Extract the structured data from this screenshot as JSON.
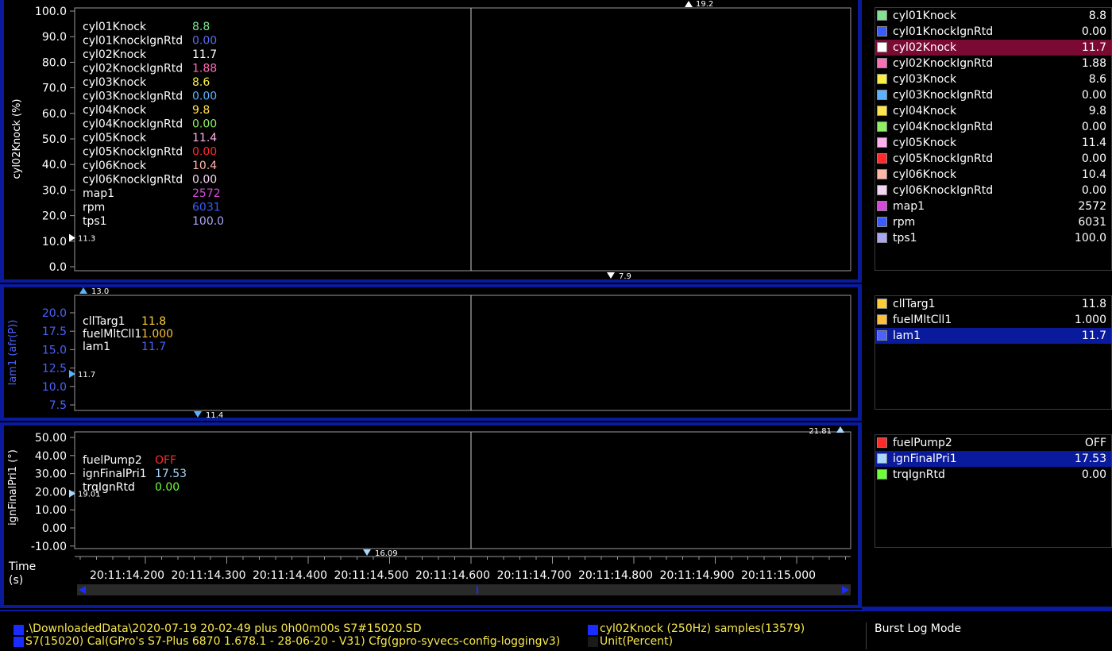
{
  "colors": {
    "frame": "#0a1a9c",
    "plot_bg": "#000000",
    "knock_fill": "#3a3a40",
    "selection_red": "#7a0a32",
    "selection_blue": "#0a1a9c"
  },
  "panel1": {
    "ylabel": "cyl02Knock (%)",
    "yticks": [
      "100.0",
      "90.0",
      "80.0",
      "70.0",
      "60.0",
      "50.0",
      "40.0",
      "30.0",
      "20.0",
      "10.0",
      "0.0"
    ],
    "marker_top": "19.2",
    "marker_bottom": "7.9",
    "marker_left": "11.3",
    "overlay": [
      {
        "name": "cyl01Knock",
        "value": "8.8",
        "color": "#7fe38f"
      },
      {
        "name": "cyl01KnockIgnRtd",
        "value": "0.00",
        "color": "#5a6cf0"
      },
      {
        "name": "cyl02Knock",
        "value": "11.7",
        "color": "#ffffff"
      },
      {
        "name": "cyl02KnockIgnRtd",
        "value": "1.88",
        "color": "#ff6fb6"
      },
      {
        "name": "cyl03Knock",
        "value": "8.6",
        "color": "#f7f043"
      },
      {
        "name": "cyl03KnockIgnRtd",
        "value": "0.00",
        "color": "#5ab3ff"
      },
      {
        "name": "cyl04Knock",
        "value": "9.8",
        "color": "#ffe34a"
      },
      {
        "name": "cyl04KnockIgnRtd",
        "value": "0.00",
        "color": "#8cf060"
      },
      {
        "name": "cyl05Knock",
        "value": "11.4",
        "color": "#ffb0ee"
      },
      {
        "name": "cyl05KnockIgnRtd",
        "value": "0.00",
        "color": "#ff2a2a"
      },
      {
        "name": "cyl06Knock",
        "value": "10.4",
        "color": "#ffb7a8"
      },
      {
        "name": "cyl06KnockIgnRtd",
        "value": "0.00",
        "color": "#f3d6f3"
      },
      {
        "name": "map1",
        "value": "2572",
        "color": "#d54ad8"
      },
      {
        "name": "rpm",
        "value": "6031",
        "color": "#3a5cff"
      },
      {
        "name": "tps1",
        "value": "100.0",
        "color": "#a9a6f2"
      }
    ]
  },
  "panel2": {
    "ylabel": "lam1 (afr(P))",
    "yticks": [
      "20.0",
      "17.5",
      "15.0",
      "12.5",
      "10.0",
      "7.5"
    ],
    "marker_top": "13.0",
    "marker_bottom": "11.4",
    "marker_left": "11.7",
    "overlay": [
      {
        "name": "cllTarg1",
        "value": "11.8",
        "color": "#ffcc33"
      },
      {
        "name": "fuelMltCll1",
        "value": "1.000",
        "color": "#ffbf3a"
      },
      {
        "name": "lam1",
        "value": "11.7",
        "color": "#4b62ff"
      }
    ]
  },
  "panel3": {
    "ylabel": "ignFinalPri1 (°)",
    "yticks": [
      "50.00",
      "40.00",
      "30.00",
      "20.00",
      "10.00",
      "0.00",
      "-10.00"
    ],
    "marker_top": "21.81",
    "marker_bottom": "16.09",
    "marker_left": "19.01",
    "overlay": [
      {
        "name": "fuelPump2",
        "value": "OFF",
        "color": "#ff2a2a"
      },
      {
        "name": "ignFinalPri1",
        "value": "17.53",
        "color": "#a9d8ff"
      },
      {
        "name": "trqIgnRtd",
        "value": "0.00",
        "color": "#6cff3a"
      }
    ]
  },
  "time_axis": {
    "label_line1": "Time",
    "label_line2": "(s)",
    "ticks": [
      "20:11:14.200",
      "20:11:14.300",
      "20:11:14.400",
      "20:11:14.500",
      "20:11:14.600",
      "20:11:14.700",
      "20:11:14.800",
      "20:11:14.900",
      "20:11:15.000"
    ]
  },
  "legend1": [
    {
      "name": "cyl01Knock",
      "value": "8.8",
      "color": "#7fe38f"
    },
    {
      "name": "cyl01KnockIgnRtd",
      "value": "0.00",
      "color": "#3a5cff"
    },
    {
      "name": "cyl02Knock",
      "value": "11.7",
      "color": "#ffffff",
      "selected": "red"
    },
    {
      "name": "cyl02KnockIgnRtd",
      "value": "1.88",
      "color": "#ff6fb6"
    },
    {
      "name": "cyl03Knock",
      "value": "8.6",
      "color": "#f7f043"
    },
    {
      "name": "cyl03KnockIgnRtd",
      "value": "0.00",
      "color": "#5ab3ff"
    },
    {
      "name": "cyl04Knock",
      "value": "9.8",
      "color": "#ffe34a"
    },
    {
      "name": "cyl04KnockIgnRtd",
      "value": "0.00",
      "color": "#8cf060"
    },
    {
      "name": "cyl05Knock",
      "value": "11.4",
      "color": "#ffb0ee"
    },
    {
      "name": "cyl05KnockIgnRtd",
      "value": "0.00",
      "color": "#ff2a2a"
    },
    {
      "name": "cyl06Knock",
      "value": "10.4",
      "color": "#ffb7a8"
    },
    {
      "name": "cyl06KnockIgnRtd",
      "value": "0.00",
      "color": "#f3d6f3"
    },
    {
      "name": "map1",
      "value": "2572",
      "color": "#d54ad8"
    },
    {
      "name": "rpm",
      "value": "6031",
      "color": "#3a5cff"
    },
    {
      "name": "tps1",
      "value": "100.0",
      "color": "#a9a6f2"
    }
  ],
  "legend2": [
    {
      "name": "cllTarg1",
      "value": "11.8",
      "color": "#ffcc33"
    },
    {
      "name": "fuelMltCll1",
      "value": "1.000",
      "color": "#ffbf3a"
    },
    {
      "name": "lam1",
      "value": "11.7",
      "color": "#4b62ff",
      "selected": "blue"
    }
  ],
  "legend3": [
    {
      "name": "fuelPump2",
      "value": "OFF",
      "color": "#ff2a2a"
    },
    {
      "name": "ignFinalPri1",
      "value": "17.53",
      "color": "#a9d8ff",
      "selected": "blue"
    },
    {
      "name": "trqIgnRtd",
      "value": "0.00",
      "color": "#6cff3a"
    }
  ],
  "status": {
    "file_path": ".\\DownloadedData\\2020-07-19 20-02-49 plus 0h00m00s S7#15020.SD",
    "cal_info": "S7(15020) Cal(GPro's S7-Plus 6870 1.678.1 - 28-06-20 - V31) Cfg(gpro-syvecs-config-loggingv3)",
    "channel_info": "cyl02Knock (250Hz) samples(13579)",
    "unit_info": "Unit(Percent)",
    "mode": "Burst Log Mode"
  }
}
